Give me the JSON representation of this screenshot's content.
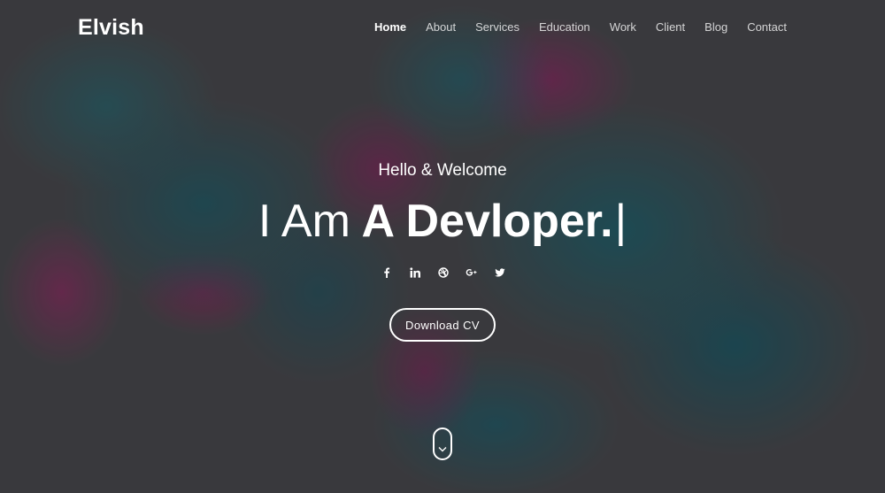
{
  "brand": "Elvish",
  "nav": {
    "items": [
      "Home",
      "About",
      "Services",
      "Education",
      "Work",
      "Client",
      "Blog",
      "Contact"
    ],
    "active": "Home"
  },
  "hero": {
    "greeting": "Hello & Welcome",
    "headline_prefix": "I Am",
    "headline_highlight": "A Devloper.",
    "cursor": "|",
    "cta_label": "Download CV"
  },
  "social_icons": [
    "facebook-icon",
    "linkedin-icon",
    "dribbble-icon",
    "google-plus-icon",
    "twitter-icon"
  ],
  "colors": {
    "overlay": "#3f3f42",
    "teal": "#225660",
    "magenta": "#80285c",
    "text": "#ffffff"
  }
}
